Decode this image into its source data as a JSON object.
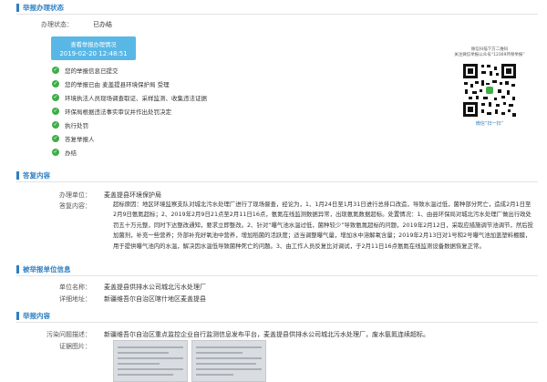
{
  "sections": {
    "progress": {
      "title": "举报办理状态"
    },
    "reply": {
      "title": "答复内容"
    },
    "reported": {
      "title": "被举报单位信息"
    },
    "content": {
      "title": "举报内容"
    }
  },
  "status": {
    "label": "办理状态：",
    "value": "已办结"
  },
  "status_card": {
    "title": "查看举报办理情况",
    "date": "2019-02-20 12:48:51"
  },
  "steps": [
    {
      "text": "您的举报信息已提交"
    },
    {
      "text": "您的举报已由 麦盖提县环境保护局 受理"
    },
    {
      "text": "环境执法人员现场调查取证、采样监测、收集违法证据"
    },
    {
      "text": "环保局根据违法事实审议并作出处罚决定"
    },
    {
      "text": "执行处罚"
    },
    {
      "text": "答复举报人"
    },
    {
      "text": "办结"
    }
  ],
  "qr": {
    "caption1": "微信扫描下方二维码",
    "caption2": "关注微信举报公众号“12369环保举报”",
    "bottom": "微信“扫一扫”"
  },
  "reply": {
    "unit_label": "办理单位：",
    "unit_value": "麦盖提县环境保护局",
    "content_label": "答复内容：",
    "content_text": "超标原因：地区环境监察支队对城北污水处理厂进行了现场督查，经论为，1、1月24日至1月31日进行总排口改造，导致水温过低，菌种部分死亡，造成2月1日至2月9日氨氮超标；2、2019年2月9日21点至2月11日16点，氨氮在线监测数据异常，出现氨氮数据超标。处置情况：1、由县环保局对城北污水处理厂做出行政处罚五十万元整，同时下达整改通知，要求立即整改。2、针对“曝气池水温过低，菌种较少”导致氨氮超标的问题，2019年2月12日，采取应措施调节池调节，然后投加菌剂，补充一些营养；外部补充好氧池中营养，增加稻菌的活跃度；适当调整曝气量，增加水中溶解氧含量；2019年2月13日对1号和2号曝气池加盖塑料棚膜，用于提供曝气池内的水温，解决因水温低导致菌种死亡的问题。3、由工作人员反复比对调试，于2月11日16点氨氮在线监测设备数据恢复正常。"
  },
  "reported": {
    "name_label": "单位名称：",
    "name_value": "麦盖提县供排水公司城北污水处理厂",
    "addr_label": "详细地址：",
    "addr_value": "新疆维吾尔自治区喀什地区麦盖提县"
  },
  "content": {
    "problem_label": "污染问题描述：",
    "problem_value": "新疆维吾尔自治区重点监控企业自行监测信息发布平台，麦盖提县供排水公司城北污水处理厂，废水氨氮连续超标。",
    "photo_label": "证据图片："
  }
}
